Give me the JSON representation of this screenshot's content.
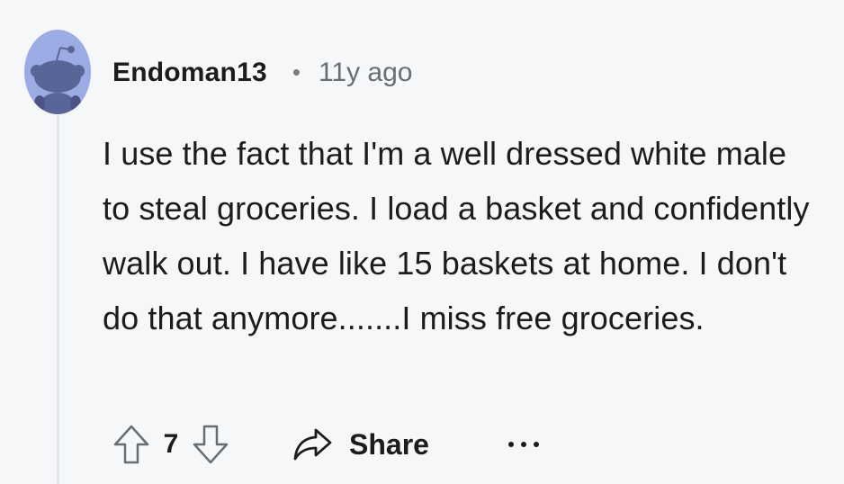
{
  "comment": {
    "author": "Endoman13",
    "separator": "•",
    "age": "11y ago",
    "body": "I use the fact that I'm a well dressed white male to steal groceries. I load a basket and confidently walk out. I have like 15 baskets at home. I don't do that anymore.......I miss free groceries.",
    "avatar_icon": "snoo-avatar-icon"
  },
  "actions": {
    "score": "7",
    "share_label": "Share",
    "upvote_icon": "arrow-up-icon",
    "downvote_icon": "arrow-down-icon",
    "share_icon": "share-arrow-icon",
    "more_icon": "more-horizontal-icon"
  },
  "colors": {
    "background": "#f6f7f8",
    "avatar_bg": "#9dabe5",
    "snoo": "#5a6597",
    "text": "#1c1c1c",
    "muted": "#6a6d70",
    "icon_stroke": "#6a6d70",
    "thread_line": "#e2e5e8"
  }
}
